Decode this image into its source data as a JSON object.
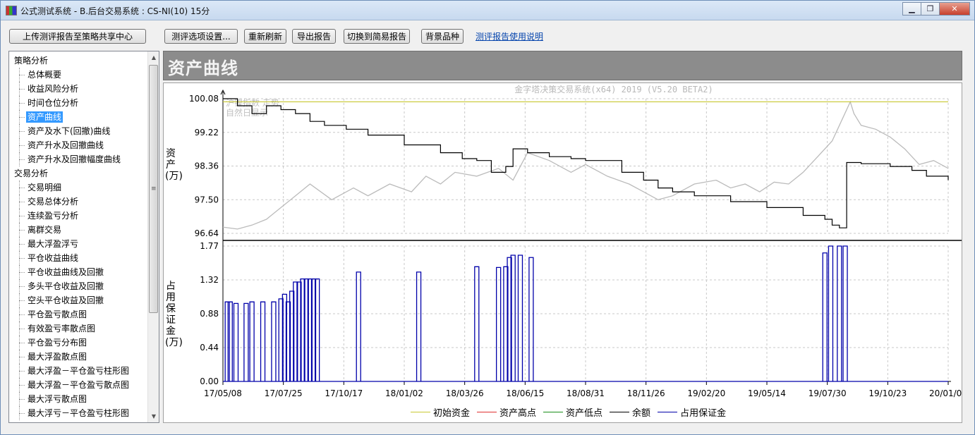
{
  "window": {
    "title": "公式测试系统 - B.后台交易系统 : CS-NI(10) 15分",
    "btn_min": "▁",
    "btn_max": "❐",
    "btn_close": "✕"
  },
  "toolbar": {
    "upload": "上传测评报告至策略共享中心",
    "options": "测评选项设置...",
    "refresh": "重新刷新",
    "export": "导出报告",
    "switch_simple": "切换到简易报告",
    "bg_variety": "背景品种",
    "help_link": "测评报告使用说明"
  },
  "tree": {
    "groups": [
      {
        "label": "策略分析",
        "items": [
          "总体概要",
          "收益风险分析",
          "时间仓位分析",
          "资产曲线",
          "资产及水下(回撤)曲线",
          "资产升水及回撤曲线",
          "资产升水及回撤幅度曲线"
        ]
      },
      {
        "label": "交易分析",
        "items": [
          "交易明细",
          "交易总体分析",
          "连续盈亏分析",
          "离群交易",
          "最大浮盈浮亏",
          "平仓收益曲线",
          "平仓收益曲线及回撤",
          "多头平仓收益及回撤",
          "空头平仓收益及回撤",
          "平仓盈亏散点图",
          "有效盈亏率散点图",
          "平仓盈亏分布图",
          "最大浮盈散点图",
          "最大浮盈－平仓盈亏柱形图",
          "最大浮盈－平仓盈亏散点图",
          "最大浮亏散点图",
          "最大浮亏－平仓盈亏柱形图"
        ]
      }
    ],
    "selected": "资产曲线"
  },
  "band": {
    "title": "资产曲线"
  },
  "chart_data": {
    "type": "line",
    "watermark": "金字塔决策交易系统(x64) 2019 (V5.20 BETA2)",
    "overlay_text_1": "沪镍指数 走势",
    "overlay_text_2": "自然日显示",
    "upper": {
      "ylabel": "资产(万)",
      "yticks": [
        "100.08",
        "99.22",
        "98.36",
        "97.50",
        "96.64"
      ],
      "ylim": [
        96.64,
        100.08
      ]
    },
    "lower": {
      "ylabel": "占用保证金(万)",
      "yticks": [
        "1.77",
        "1.32",
        "0.88",
        "0.44",
        "0.00"
      ],
      "ylim": [
        0,
        1.77
      ]
    },
    "xticks": [
      "17/05/08",
      "17/07/25",
      "17/10/17",
      "18/01/02",
      "18/03/26",
      "18/06/15",
      "18/08/31",
      "18/11/26",
      "19/02/20",
      "19/05/14",
      "19/07/30",
      "19/10/23",
      "20/01/08"
    ],
    "initial_capital": 100.0,
    "balance_x": [
      0,
      0.02,
      0.04,
      0.06,
      0.08,
      0.1,
      0.12,
      0.14,
      0.17,
      0.2,
      0.25,
      0.3,
      0.33,
      0.35,
      0.37,
      0.38,
      0.39,
      0.4,
      0.42,
      0.45,
      0.48,
      0.5,
      0.55,
      0.58,
      0.6,
      0.62,
      0.65,
      0.7,
      0.75,
      0.8,
      0.83,
      0.84,
      0.85,
      0.855,
      0.86,
      0.88,
      0.92,
      0.95,
      0.97,
      1.0
    ],
    "balance_y": [
      100.08,
      99.9,
      99.7,
      99.9,
      99.8,
      99.7,
      99.5,
      99.4,
      99.3,
      99.15,
      98.9,
      98.7,
      98.55,
      98.5,
      98.2,
      98.2,
      98.35,
      98.8,
      98.7,
      98.6,
      98.55,
      98.5,
      98.2,
      98.0,
      97.8,
      97.7,
      97.6,
      97.45,
      97.3,
      97.1,
      97.0,
      96.85,
      96.78,
      96.78,
      98.45,
      98.42,
      98.35,
      98.25,
      98.1,
      98.0
    ],
    "price_x": [
      0,
      0.02,
      0.04,
      0.06,
      0.08,
      0.1,
      0.12,
      0.15,
      0.18,
      0.2,
      0.23,
      0.26,
      0.28,
      0.3,
      0.32,
      0.35,
      0.38,
      0.4,
      0.42,
      0.45,
      0.48,
      0.5,
      0.53,
      0.56,
      0.58,
      0.6,
      0.62,
      0.65,
      0.68,
      0.7,
      0.72,
      0.74,
      0.76,
      0.78,
      0.8,
      0.82,
      0.84,
      0.85,
      0.86,
      0.865,
      0.87,
      0.88,
      0.9,
      0.92,
      0.94,
      0.96,
      0.98,
      1.0
    ],
    "price_y": [
      96.8,
      96.75,
      96.85,
      97.0,
      97.3,
      97.6,
      97.9,
      97.5,
      97.8,
      97.6,
      97.9,
      97.7,
      98.1,
      97.9,
      98.2,
      98.1,
      98.3,
      98.0,
      98.7,
      98.5,
      98.2,
      98.4,
      98.1,
      97.9,
      97.7,
      97.5,
      97.6,
      97.9,
      98.0,
      97.8,
      97.9,
      97.7,
      97.95,
      97.9,
      98.2,
      98.6,
      99.0,
      99.4,
      99.8,
      100.0,
      99.7,
      99.4,
      99.3,
      99.1,
      98.8,
      98.4,
      98.5,
      98.3
    ],
    "margin_x": [
      0.006,
      0.01,
      0.018,
      0.032,
      0.04,
      0.055,
      0.07,
      0.08,
      0.085,
      0.09,
      0.095,
      0.1,
      0.105,
      0.11,
      0.115,
      0.12,
      0.125,
      0.13,
      0.187,
      0.27,
      0.35,
      0.38,
      0.39,
      0.395,
      0.4,
      0.41,
      0.425,
      0.83,
      0.838,
      0.85,
      0.858
    ],
    "margin_y": [
      1.04,
      1.04,
      1.02,
      1.02,
      1.04,
      1.04,
      1.04,
      1.08,
      1.14,
      1.04,
      1.18,
      1.3,
      1.3,
      1.34,
      1.34,
      1.34,
      1.34,
      1.34,
      1.43,
      1.43,
      1.5,
      1.49,
      1.5,
      1.62,
      1.65,
      1.65,
      1.62,
      1.68,
      1.77,
      1.77,
      1.77
    ],
    "legend": [
      "初始资金",
      "资产高点",
      "资产低点",
      "余额",
      "占用保证金"
    ],
    "colors": {
      "initial": "#c8c832",
      "high": "#e03030",
      "low": "#1a8f1a",
      "balance": "#000000",
      "margin": "#0000aa",
      "price": "#bbbbbb"
    }
  }
}
